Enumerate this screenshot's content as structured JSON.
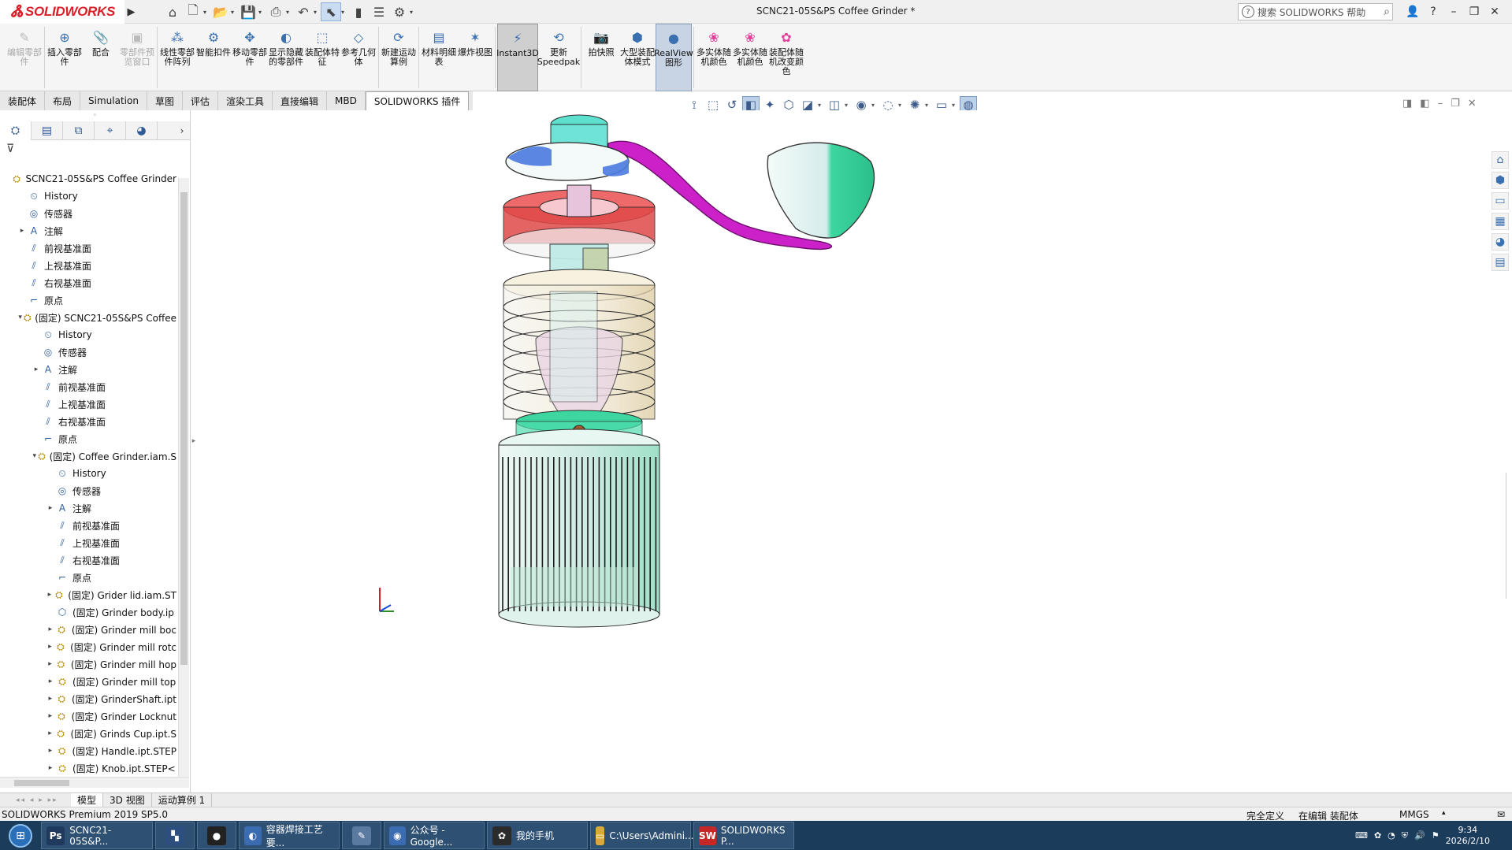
{
  "titlebar": {
    "logo_text": "SOLIDWORKS",
    "doc_title": "SCNC21-05S&PS Coffee Grinder *",
    "help_placeholder": "搜索 SOLIDWORKS 帮助"
  },
  "ribbon": [
    {
      "id": "edit",
      "label": "编辑零部件",
      "icon": "edit-component-icon",
      "disabled": true
    },
    {
      "id": "insert",
      "label": "插入零部件",
      "icon": "insert-component-icon"
    },
    {
      "id": "mate",
      "label": "配合",
      "icon": "mate-icon"
    },
    {
      "id": "preview",
      "label": "零部件预览窗口",
      "icon": "preview-window-icon",
      "disabled": true
    },
    {
      "id": "linear",
      "label": "线性零部件阵列",
      "icon": "linear-pattern-icon"
    },
    {
      "id": "smartfast",
      "label": "智能扣件",
      "icon": "smart-fastener-icon"
    },
    {
      "id": "move",
      "label": "移动零部件",
      "icon": "move-component-icon"
    },
    {
      "id": "showhide",
      "label": "显示隐藏的零部件",
      "icon": "show-hidden-icon"
    },
    {
      "id": "asmfeature",
      "label": "装配体特征",
      "icon": "assembly-feature-icon"
    },
    {
      "id": "refgeom",
      "label": "参考几何体",
      "icon": "reference-geometry-icon"
    },
    {
      "id": "motion",
      "label": "新建运动算例",
      "icon": "motion-study-icon"
    },
    {
      "id": "bom",
      "label": "材料明细表",
      "icon": "bom-icon"
    },
    {
      "id": "explode",
      "label": "爆炸视图",
      "icon": "exploded-view-icon"
    },
    {
      "id": "instant3d",
      "label": "Instant3D",
      "icon": "instant3d-icon",
      "active": true
    },
    {
      "id": "speedpak",
      "label": "更新Speedpak",
      "icon": "speedpak-icon"
    },
    {
      "id": "snapshot",
      "label": "拍快照",
      "icon": "snapshot-icon"
    },
    {
      "id": "largeasm",
      "label": "大型装配体模式",
      "icon": "large-assembly-icon"
    },
    {
      "id": "realview",
      "label": "RealView图形",
      "icon": "realview-icon",
      "active": true
    },
    {
      "id": "multibody1",
      "label": "多实体随机颜色",
      "icon": "random-color-icon"
    },
    {
      "id": "multibody2",
      "label": "多实体随机颜色",
      "icon": "random-color-icon"
    },
    {
      "id": "asmrandom",
      "label": "装配体随机改变颜色",
      "icon": "assembly-color-icon"
    }
  ],
  "tabs": [
    "装配体",
    "布局",
    "Simulation",
    "草图",
    "评估",
    "渲染工具",
    "直接编辑",
    "MBD",
    "SOLIDWORKS 插件"
  ],
  "tree": [
    {
      "level": 0,
      "label": "SCNC21-05S&PS Coffee Grinder",
      "icon": "assembly-icon",
      "toggle": ""
    },
    {
      "level": 1,
      "label": "History",
      "icon": "history-icon",
      "toggle": ""
    },
    {
      "level": 1,
      "label": "传感器",
      "icon": "sensor-icon",
      "toggle": ""
    },
    {
      "level": 1,
      "label": "注解",
      "icon": "annotation-icon",
      "toggle": "▸"
    },
    {
      "level": 1,
      "label": "前视基准面",
      "icon": "plane-icon",
      "toggle": ""
    },
    {
      "level": 1,
      "label": "上视基准面",
      "icon": "plane-icon",
      "toggle": ""
    },
    {
      "level": 1,
      "label": "右视基准面",
      "icon": "plane-icon",
      "toggle": ""
    },
    {
      "level": 1,
      "label": "原点",
      "icon": "origin-icon",
      "toggle": ""
    },
    {
      "level": 1,
      "label": "(固定) SCNC21-05S&PS Coffee",
      "icon": "subassembly-icon",
      "toggle": "▾"
    },
    {
      "level": 2,
      "label": "History",
      "icon": "history-icon",
      "toggle": ""
    },
    {
      "level": 2,
      "label": "传感器",
      "icon": "sensor-icon",
      "toggle": ""
    },
    {
      "level": 2,
      "label": "注解",
      "icon": "annotation-icon",
      "toggle": "▸"
    },
    {
      "level": 2,
      "label": "前视基准面",
      "icon": "plane-icon",
      "toggle": ""
    },
    {
      "level": 2,
      "label": "上视基准面",
      "icon": "plane-icon",
      "toggle": ""
    },
    {
      "level": 2,
      "label": "右视基准面",
      "icon": "plane-icon",
      "toggle": ""
    },
    {
      "level": 2,
      "label": "原点",
      "icon": "origin-icon",
      "toggle": ""
    },
    {
      "level": 2,
      "label": "(固定) Coffee Grinder.iam.S",
      "icon": "subassembly-icon",
      "toggle": "▾"
    },
    {
      "level": 3,
      "label": "History",
      "icon": "history-icon",
      "toggle": ""
    },
    {
      "level": 3,
      "label": "传感器",
      "icon": "sensor-icon",
      "toggle": ""
    },
    {
      "level": 3,
      "label": "注解",
      "icon": "annotation-icon",
      "toggle": "▸"
    },
    {
      "level": 3,
      "label": "前视基准面",
      "icon": "plane-icon",
      "toggle": ""
    },
    {
      "level": 3,
      "label": "上视基准面",
      "icon": "plane-icon",
      "toggle": ""
    },
    {
      "level": 3,
      "label": "右视基准面",
      "icon": "plane-icon",
      "toggle": ""
    },
    {
      "level": 3,
      "label": "原点",
      "icon": "origin-icon",
      "toggle": ""
    },
    {
      "level": 3,
      "label": "(固定) Grider lid.iam.ST",
      "icon": "subassembly-icon",
      "toggle": "▸"
    },
    {
      "level": 3,
      "label": "(固定) Grinder body.ip",
      "icon": "part-icon",
      "toggle": ""
    },
    {
      "level": 3,
      "label": "(固定) Grinder mill boc",
      "icon": "subassembly-icon",
      "toggle": "▸"
    },
    {
      "level": 3,
      "label": "(固定) Grinder mill rotc",
      "icon": "subassembly-icon",
      "toggle": "▸"
    },
    {
      "level": 3,
      "label": "(固定) Grinder mill hop",
      "icon": "subassembly-icon",
      "toggle": "▸"
    },
    {
      "level": 3,
      "label": "(固定) Grinder mill top",
      "icon": "subassembly-icon",
      "toggle": "▸"
    },
    {
      "level": 3,
      "label": "(固定) GrinderShaft.ipt",
      "icon": "subassembly-icon",
      "toggle": "▸"
    },
    {
      "level": 3,
      "label": "(固定) Grinder Locknut",
      "icon": "subassembly-icon",
      "toggle": "▸"
    },
    {
      "level": 3,
      "label": "(固定) Grinds Cup.ipt.S",
      "icon": "subassembly-icon",
      "toggle": "▸"
    },
    {
      "level": 3,
      "label": "(固定) Handle.ipt.STEP",
      "icon": "subassembly-icon",
      "toggle": "▸"
    },
    {
      "level": 3,
      "label": "(固定) Knob.ipt.STEP<",
      "icon": "subassembly-icon",
      "toggle": "▸"
    }
  ],
  "bottom_tabs": [
    "模型",
    "3D 视图",
    "运动算例 1"
  ],
  "status": {
    "app": "SOLIDWORKS Premium 2019 SP5.0",
    "defined": "完全定义",
    "editing": "在编辑 装配体",
    "units": "MMGS"
  },
  "taskbar": [
    {
      "label": "SCNC21-05S&P...",
      "icon": "photoshop-icon",
      "color": "#1f3a5c",
      "glyph": "Ps"
    },
    {
      "label": "",
      "icon": "app-grid-icon",
      "color": "#2c4f80",
      "glyph": "▚"
    },
    {
      "label": "",
      "icon": "record-icon",
      "color": "#222",
      "glyph": "●"
    },
    {
      "label": "容器焊接工艺要...",
      "icon": "browser-icon",
      "color": "#3b6bb0",
      "glyph": "◐"
    },
    {
      "label": "",
      "icon": "paint-icon",
      "color": "#5a7aa0",
      "glyph": "✎"
    },
    {
      "label": "公众号 - Google...",
      "icon": "chrome-icon",
      "color": "#3b6bb0",
      "glyph": "◉"
    },
    {
      "label": "我的手机",
      "icon": "qq-icon",
      "color": "#2b2b2b",
      "glyph": "✿"
    },
    {
      "label": "C:\\Users\\Admini...",
      "icon": "folder-icon",
      "color": "#d9a93a",
      "glyph": "▭"
    },
    {
      "label": "SOLIDWORKS P...",
      "icon": "solidworks-icon",
      "color": "#c62828",
      "glyph": "SW"
    }
  ],
  "clock": {
    "time": "9:34",
    "date": "2026/2/10"
  },
  "colors": {
    "accent": "#d8202a",
    "handle": "#cc20c8",
    "teal": "#3ed6a0",
    "red": "#e04848"
  }
}
